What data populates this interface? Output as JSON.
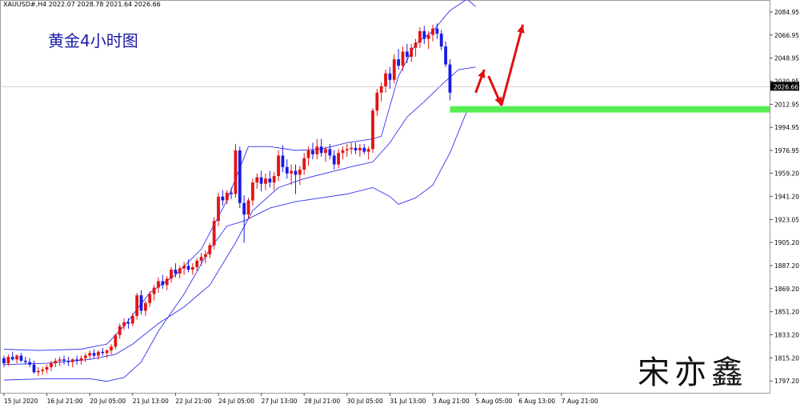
{
  "header": {
    "info": "XAUUSD#,H4  2022.07 2028.78 2021.64 2026.66"
  },
  "title": "黄金4小时图",
  "watermark": "宋亦鑫",
  "colors": {
    "bull": "#e21414",
    "bear": "#1a1ae6",
    "band": "#3333ee",
    "support": "#55ee55",
    "arrow": "#e01010",
    "price_line": "#c8c8c8"
  },
  "chart_data": {
    "type": "candlestick",
    "symbol": "XAUUSD#",
    "timeframe": "H4",
    "ylim": [
      1788.0,
      2093.0
    ],
    "y_ticks": [
      "2084.95",
      "2066.95",
      "2048.95",
      "2030.95",
      "2012.95",
      "1994.95",
      "1976.95",
      "1959.20",
      "1941.20",
      "1923.05",
      "1905.20",
      "1887.20",
      "1869.20",
      "1851.20",
      "1833.20",
      "1815.20",
      "1797.20"
    ],
    "x_ticks": [
      {
        "label": "15 Jul 2020",
        "index": 0
      },
      {
        "label": "16 Jul 21:00",
        "index": 10
      },
      {
        "label": "20 Jul 05:00",
        "index": 20
      },
      {
        "label": "21 Jul 13:00",
        "index": 30
      },
      {
        "label": "22 Jul 21:00",
        "index": 40
      },
      {
        "label": "24 Jul 05:00",
        "index": 50
      },
      {
        "label": "27 Jul 13:00",
        "index": 60
      },
      {
        "label": "28 Jul 21:00",
        "index": 70
      },
      {
        "label": "30 Jul 05:00",
        "index": 80
      },
      {
        "label": "31 Jul 13:00",
        "index": 90
      },
      {
        "label": "3 Aug 21:00",
        "index": 100
      },
      {
        "label": "5 Aug 05:00",
        "index": 110
      },
      {
        "label": "6 Aug 13:00",
        "index": 120
      },
      {
        "label": "7 Aug 21:00",
        "index": 130
      }
    ],
    "current_price": "2026.66",
    "support_level": 2009.0,
    "ohlc": [
      [
        1815,
        1817,
        1808,
        1811
      ],
      [
        1811,
        1818,
        1809,
        1816
      ],
      [
        1816,
        1820,
        1813,
        1814
      ],
      [
        1814,
        1818,
        1811,
        1817
      ],
      [
        1817,
        1819,
        1812,
        1813
      ],
      [
        1813,
        1816,
        1810,
        1812
      ],
      [
        1812,
        1815,
        1808,
        1810
      ],
      [
        1810,
        1813,
        1803,
        1804
      ],
      [
        1804,
        1808,
        1801,
        1805
      ],
      [
        1805,
        1808,
        1802,
        1806
      ],
      [
        1806,
        1810,
        1803,
        1808
      ],
      [
        1808,
        1813,
        1805,
        1811
      ],
      [
        1811,
        1815,
        1808,
        1813
      ],
      [
        1813,
        1816,
        1809,
        1814
      ],
      [
        1814,
        1817,
        1810,
        1813
      ],
      [
        1813,
        1816,
        1809,
        1812
      ],
      [
        1812,
        1815,
        1808,
        1814
      ],
      [
        1814,
        1817,
        1810,
        1813
      ],
      [
        1813,
        1817,
        1810,
        1815
      ],
      [
        1815,
        1819,
        1812,
        1817
      ],
      [
        1817,
        1821,
        1814,
        1819
      ],
      [
        1819,
        1822,
        1815,
        1817
      ],
      [
        1817,
        1821,
        1814,
        1820
      ],
      [
        1820,
        1823,
        1817,
        1819
      ],
      [
        1819,
        1822,
        1815,
        1821
      ],
      [
        1821,
        1826,
        1818,
        1824
      ],
      [
        1824,
        1834,
        1822,
        1833
      ],
      [
        1833,
        1842,
        1830,
        1840
      ],
      [
        1840,
        1846,
        1837,
        1843
      ],
      [
        1843,
        1846,
        1838,
        1842
      ],
      [
        1842,
        1850,
        1840,
        1848
      ],
      [
        1848,
        1866,
        1845,
        1864
      ],
      [
        1864,
        1868,
        1849,
        1852
      ],
      [
        1852,
        1860,
        1848,
        1858
      ],
      [
        1858,
        1867,
        1855,
        1865
      ],
      [
        1865,
        1872,
        1860,
        1870
      ],
      [
        1870,
        1878,
        1866,
        1875
      ],
      [
        1875,
        1880,
        1869,
        1872
      ],
      [
        1872,
        1879,
        1868,
        1877
      ],
      [
        1877,
        1886,
        1874,
        1884
      ],
      [
        1884,
        1889,
        1878,
        1881
      ],
      [
        1881,
        1887,
        1877,
        1885
      ],
      [
        1885,
        1890,
        1880,
        1887
      ],
      [
        1887,
        1892,
        1882,
        1884
      ],
      [
        1884,
        1889,
        1880,
        1886
      ],
      [
        1886,
        1893,
        1883,
        1891
      ],
      [
        1891,
        1897,
        1887,
        1894
      ],
      [
        1894,
        1899,
        1889,
        1896
      ],
      [
        1896,
        1905,
        1893,
        1903
      ],
      [
        1903,
        1925,
        1900,
        1922
      ],
      [
        1922,
        1944,
        1918,
        1941
      ],
      [
        1941,
        1946,
        1934,
        1938
      ],
      [
        1938,
        1946,
        1935,
        1944
      ],
      [
        1944,
        1948,
        1939,
        1943
      ],
      [
        1943,
        1982,
        1940,
        1977
      ],
      [
        1977,
        1980,
        1932,
        1936
      ],
      [
        1936,
        1942,
        1905,
        1927
      ],
      [
        1927,
        1940,
        1924,
        1938
      ],
      [
        1938,
        1955,
        1934,
        1952
      ],
      [
        1952,
        1959,
        1947,
        1956
      ],
      [
        1956,
        1961,
        1945,
        1951
      ],
      [
        1951,
        1959,
        1946,
        1955
      ],
      [
        1955,
        1961,
        1948,
        1952
      ],
      [
        1952,
        1960,
        1946,
        1957
      ],
      [
        1957,
        1977,
        1953,
        1973
      ],
      [
        1973,
        1981,
        1960,
        1964
      ],
      [
        1964,
        1970,
        1955,
        1959
      ],
      [
        1959,
        1966,
        1950,
        1961
      ],
      [
        1961,
        1966,
        1943,
        1958
      ],
      [
        1958,
        1965,
        1950,
        1962
      ],
      [
        1962,
        1975,
        1958,
        1971
      ],
      [
        1971,
        1980,
        1965,
        1977
      ],
      [
        1977,
        1983,
        1970,
        1974
      ],
      [
        1974,
        1986,
        1970,
        1980
      ],
      [
        1980,
        1986,
        1972,
        1975
      ],
      [
        1975,
        1980,
        1968,
        1978
      ],
      [
        1978,
        1982,
        1970,
        1973
      ],
      [
        1973,
        1977,
        1962,
        1966
      ],
      [
        1966,
        1978,
        1963,
        1975
      ],
      [
        1975,
        1980,
        1970,
        1977
      ],
      [
        1977,
        1982,
        1972,
        1978
      ],
      [
        1978,
        1983,
        1974,
        1979
      ],
      [
        1979,
        1983,
        1974,
        1977
      ],
      [
        1977,
        1982,
        1972,
        1979
      ],
      [
        1979,
        1982,
        1974,
        1976
      ],
      [
        1976,
        1980,
        1970,
        1978
      ],
      [
        1978,
        2010,
        1975,
        2008
      ],
      [
        2008,
        2025,
        2004,
        2022
      ],
      [
        2022,
        2030,
        2015,
        2027
      ],
      [
        2027,
        2040,
        2022,
        2037
      ],
      [
        2037,
        2042,
        2025,
        2032
      ],
      [
        2032,
        2052,
        2029,
        2048
      ],
      [
        2048,
        2056,
        2040,
        2043
      ],
      [
        2043,
        2058,
        2039,
        2054
      ],
      [
        2054,
        2060,
        2045,
        2050
      ],
      [
        2050,
        2060,
        2046,
        2057
      ],
      [
        2057,
        2064,
        2050,
        2061
      ],
      [
        2061,
        2073,
        2057,
        2070
      ],
      [
        2070,
        2074,
        2060,
        2064
      ],
      [
        2064,
        2070,
        2056,
        2067
      ],
      [
        2067,
        2075,
        2062,
        2072
      ],
      [
        2072,
        2076,
        2064,
        2068
      ],
      [
        2068,
        2071,
        2055,
        2058
      ],
      [
        2058,
        2062,
        2042,
        2044
      ],
      [
        2044,
        2048,
        2016,
        2022
      ]
    ],
    "bands": {
      "upper": [
        [
          0,
          1822
        ],
        [
          8,
          1821
        ],
        [
          18,
          1822
        ],
        [
          24,
          1826
        ],
        [
          28,
          1840
        ],
        [
          34,
          1866
        ],
        [
          40,
          1880
        ],
        [
          46,
          1900
        ],
        [
          52,
          1938
        ],
        [
          57,
          1980
        ],
        [
          62,
          1980
        ],
        [
          68,
          1977
        ],
        [
          74,
          1978
        ],
        [
          80,
          1983
        ],
        [
          86,
          1986
        ],
        [
          88,
          1988
        ],
        [
          92,
          2035
        ],
        [
          96,
          2060
        ],
        [
          100,
          2070
        ],
        [
          104,
          2086
        ],
        [
          108,
          2095
        ],
        [
          110,
          2089
        ]
      ],
      "middle": [
        [
          0,
          1810
        ],
        [
          10,
          1811
        ],
        [
          20,
          1814
        ],
        [
          26,
          1818
        ],
        [
          30,
          1826
        ],
        [
          36,
          1842
        ],
        [
          42,
          1855
        ],
        [
          48,
          1872
        ],
        [
          54,
          1905
        ],
        [
          58,
          1930
        ],
        [
          64,
          1948
        ],
        [
          70,
          1955
        ],
        [
          76,
          1960
        ],
        [
          82,
          1965
        ],
        [
          86,
          1968
        ],
        [
          90,
          1983
        ],
        [
          94,
          2003
        ],
        [
          98,
          2015
        ],
        [
          102,
          2028
        ],
        [
          106,
          2040
        ],
        [
          110,
          2042
        ]
      ],
      "lower": [
        [
          0,
          1798
        ],
        [
          10,
          1799
        ],
        [
          20,
          1799
        ],
        [
          24,
          1797
        ],
        [
          28,
          1800
        ],
        [
          32,
          1812
        ],
        [
          36,
          1836
        ],
        [
          42,
          1865
        ],
        [
          48,
          1900
        ],
        [
          52,
          1918
        ],
        [
          56,
          1922
        ],
        [
          62,
          1932
        ],
        [
          68,
          1937
        ],
        [
          74,
          1940
        ],
        [
          80,
          1943
        ],
        [
          86,
          1948
        ],
        [
          90,
          1941
        ],
        [
          92,
          1935
        ],
        [
          96,
          1940
        ],
        [
          100,
          1950
        ],
        [
          104,
          1975
        ],
        [
          108,
          2008
        ]
      ]
    },
    "arrows": [
      {
        "from": [
          110,
          2022
        ],
        "to": [
          112,
          2040
        ]
      },
      {
        "from": [
          113,
          2035
        ],
        "to": [
          116,
          2012
        ]
      },
      {
        "from": [
          116,
          2012
        ],
        "to": [
          121,
          2075
        ]
      }
    ]
  }
}
